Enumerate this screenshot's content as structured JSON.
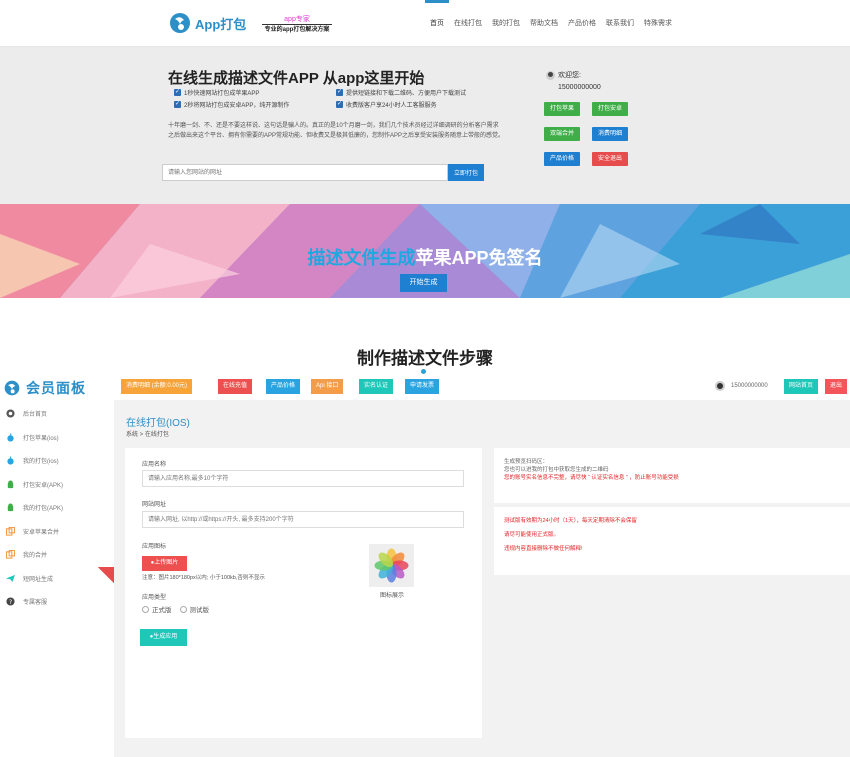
{
  "topnav": {
    "logo_text": "App打包",
    "slogan_top": "app专家",
    "slogan_bottom": "专业的app打包解决方案",
    "items": [
      {
        "label": "首页",
        "active": true
      },
      {
        "label": "在线打包"
      },
      {
        "label": "我的打包"
      },
      {
        "label": "帮助文档"
      },
      {
        "label": "产品价格"
      },
      {
        "label": "联系我们"
      },
      {
        "label": "特殊需求"
      }
    ]
  },
  "hero": {
    "title": "在线生成描述文件APP 从app这里开始",
    "features": [
      "1秒快速网站打包成苹果APP",
      "提供短链接和下载二维码、方便用户下载测试",
      "2秒将网站打包成安卓APP，纯开源制作",
      "收费版客户享24小时人工客服服务"
    ],
    "description": "十年磨一剑、不、还是不要这样说、这句话是骗人的。真正的是10个月磨一剑，我们几个技术员经过详细调研的分析客户需求之后做出来这个平台、拥有你需要的APP常规功能、但收费又是极其低廉的，您制作APP之后享受安装服务随意上带般的感觉。",
    "url_placeholder": "请输入您网站的网址",
    "url_button": "立即打包",
    "welcome_label": "欢迎您:",
    "welcome_phone": "15000000000",
    "buttons": [
      {
        "label": "打包苹果",
        "color": "#3fae49"
      },
      {
        "label": "打包安卓",
        "color": "#3fae49"
      },
      {
        "label": "双端合并",
        "color": "#3fae49"
      },
      {
        "label": "消费明细",
        "color": "#1f7fd1"
      },
      {
        "label": "产品价格",
        "color": "#1f7fd1"
      },
      {
        "label": "安全退出",
        "color": "#e74c4c"
      }
    ]
  },
  "banner": {
    "title_highlight": "描述文件生成",
    "title_rest": "苹果APP免签名",
    "button": "开始生成"
  },
  "steps": {
    "title": "制作描述文件步骤"
  },
  "member": {
    "title": "会员面板",
    "sidebar": [
      {
        "label": "后台首页",
        "icon": "dashboard-icon"
      },
      {
        "label": "打包苹果(ios)",
        "icon": "apple-icon"
      },
      {
        "label": "我的打包(ios)",
        "icon": "apple-icon"
      },
      {
        "label": "打包安卓(APK)",
        "icon": "android-icon"
      },
      {
        "label": "我的打包(APK)",
        "icon": "android-icon"
      },
      {
        "label": "安卓苹果合并",
        "icon": "merge-icon"
      },
      {
        "label": "我的合并",
        "icon": "merge-icon"
      },
      {
        "label": "短网址生成",
        "icon": "plane-icon"
      },
      {
        "label": "专属客服",
        "icon": "help-icon"
      }
    ],
    "toolbar": {
      "buttons": [
        {
          "label": "消费明细 (余额:0.00元)",
          "color": "#f6a33a"
        },
        {
          "label": "在线充值",
          "color": "#ee5050"
        },
        {
          "label": "产品价格",
          "color": "#2aa4e0"
        },
        {
          "label": "Api 接口",
          "color": "#f39c4a"
        },
        {
          "label": "实名认证",
          "color": "#1fc7b8"
        },
        {
          "label": "申请发票",
          "color": "#2aa4e0"
        }
      ],
      "user_phone": "15000000000",
      "home_button": "网站首页",
      "logout_button": "退出"
    },
    "page_title": "在线打包(IOS)",
    "breadcrumb": "系统  >  在线打包",
    "form": {
      "app_name_label": "应用名称",
      "app_name_placeholder": "请输入应用名称,最多10个字符",
      "url_label": "网站网址",
      "url_placeholder": "请输入网址, 以http://或https://开头, 最多支持200个字符",
      "icon_label": "应用图标",
      "upload_button": "上传图片",
      "icon_note": "注意：图片180*180px以内; 小于100kb,否则不显示",
      "icon_caption": "图标展示",
      "type_label": "应用类型",
      "type_options": [
        "正式版",
        "测试版"
      ],
      "submit_button": "生成应用"
    },
    "info_box_1": {
      "line1": "生成预览扫码区：",
      "line2": "您也可以进我的打包中获取您生成的二维码",
      "line3": "您的账号实名信息不完整，请尽快 “ 认证实名信息 ” ，防止账号功能受损"
    },
    "info_box_2": {
      "line1": "测试版有效期为24小时（1天），每天定期清除不会保留",
      "line2": "请尽可能使用正式版。",
      "line3": "违规内容直接删除不做任何解释!"
    }
  }
}
